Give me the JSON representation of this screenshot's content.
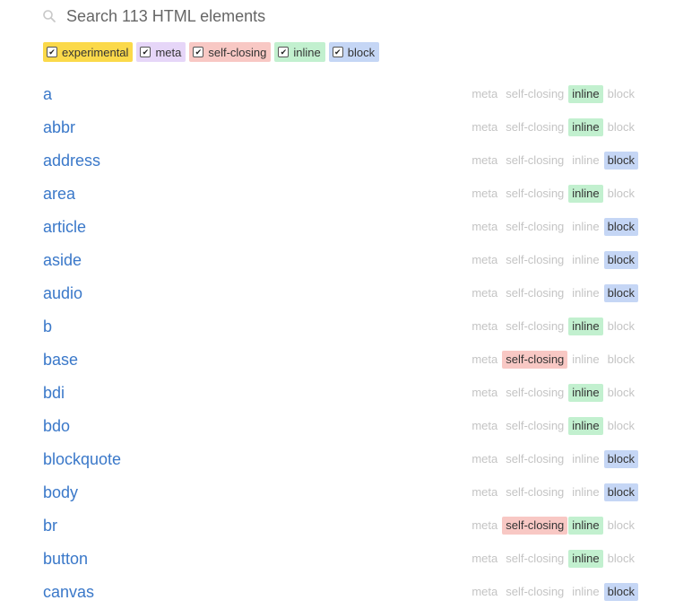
{
  "search": {
    "placeholder": "Search 113 HTML elements",
    "value": ""
  },
  "filters": [
    {
      "label": "experimental",
      "checked": true,
      "color": "#fbd94a"
    },
    {
      "label": "meta",
      "checked": true,
      "color": "#e6d6f8"
    },
    {
      "label": "self-closing",
      "checked": true,
      "color": "#f8c8c4"
    },
    {
      "label": "inline",
      "checked": true,
      "color": "#c2f0cf"
    },
    {
      "label": "block",
      "checked": true,
      "color": "#c5d6f5"
    }
  ],
  "tag_labels": [
    "meta",
    "self-closing",
    "inline",
    "block"
  ],
  "elements": [
    {
      "name": "a",
      "tags": [
        "inline"
      ]
    },
    {
      "name": "abbr",
      "tags": [
        "inline"
      ]
    },
    {
      "name": "address",
      "tags": [
        "block"
      ]
    },
    {
      "name": "area",
      "tags": [
        "inline"
      ]
    },
    {
      "name": "article",
      "tags": [
        "block"
      ]
    },
    {
      "name": "aside",
      "tags": [
        "block"
      ]
    },
    {
      "name": "audio",
      "tags": [
        "block"
      ]
    },
    {
      "name": "b",
      "tags": [
        "inline"
      ]
    },
    {
      "name": "base",
      "tags": [
        "self-closing"
      ]
    },
    {
      "name": "bdi",
      "tags": [
        "inline"
      ]
    },
    {
      "name": "bdo",
      "tags": [
        "inline"
      ]
    },
    {
      "name": "blockquote",
      "tags": [
        "block"
      ]
    },
    {
      "name": "body",
      "tags": [
        "block"
      ]
    },
    {
      "name": "br",
      "tags": [
        "self-closing",
        "inline"
      ]
    },
    {
      "name": "button",
      "tags": [
        "inline"
      ]
    },
    {
      "name": "canvas",
      "tags": [
        "block"
      ]
    }
  ]
}
